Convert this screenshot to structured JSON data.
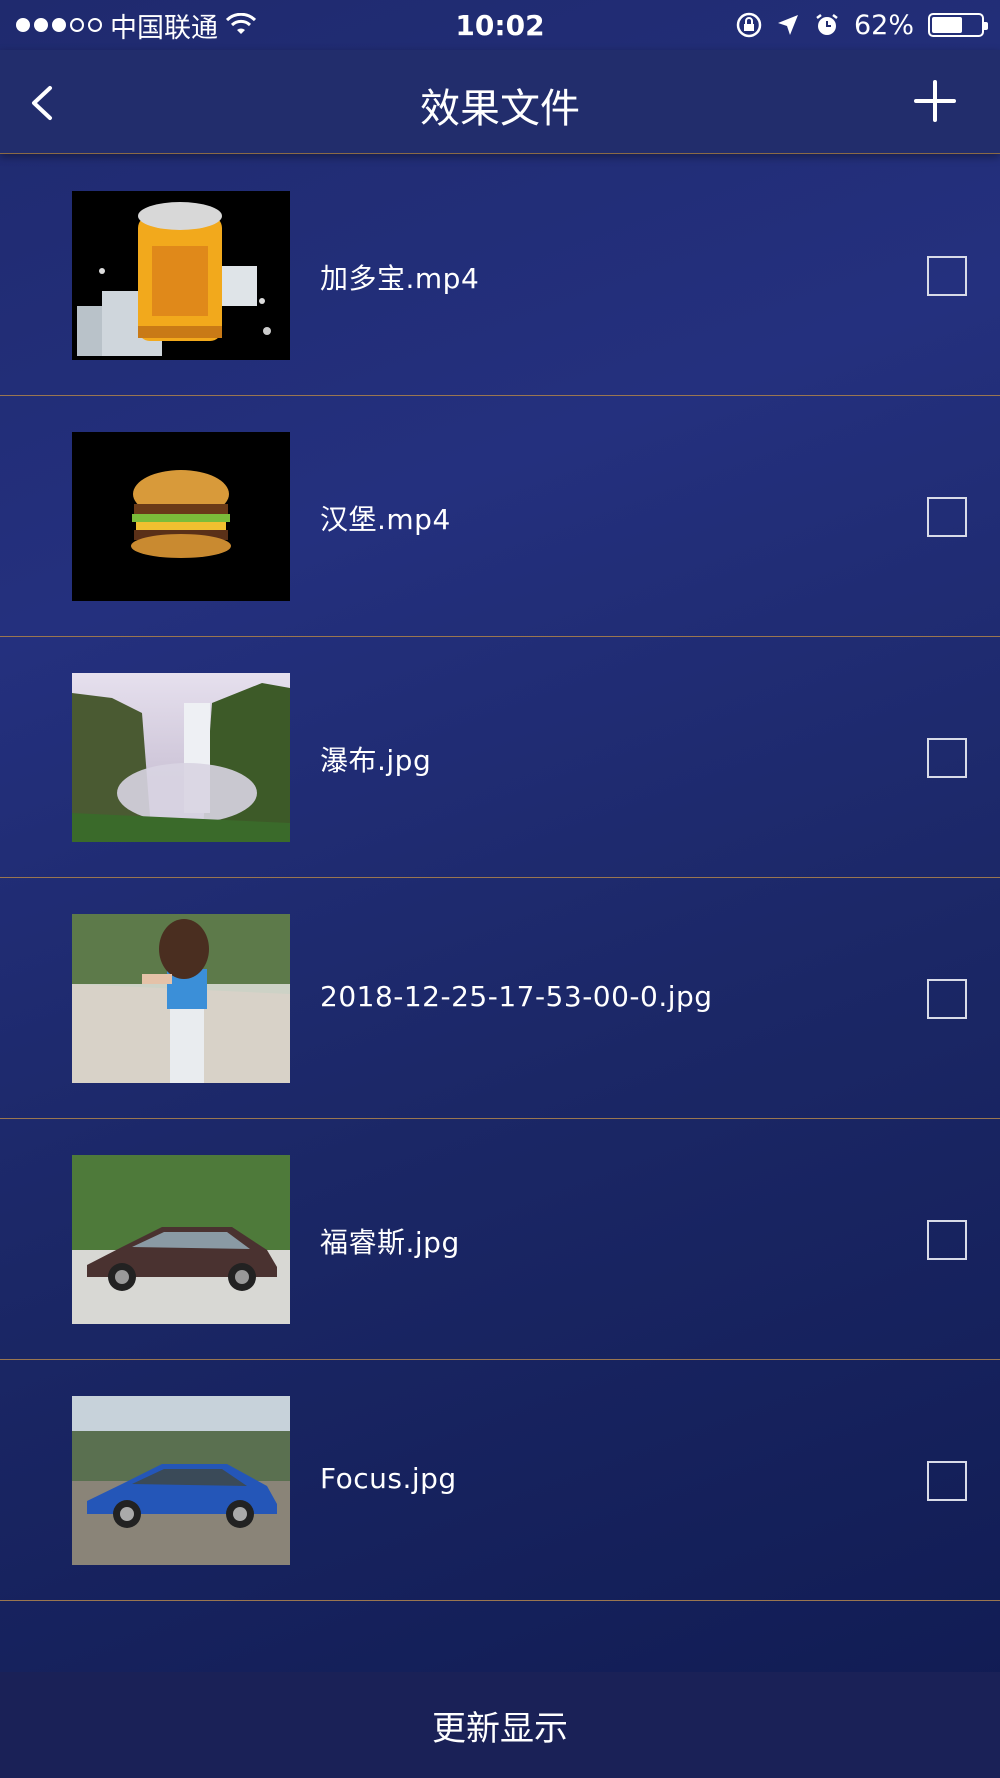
{
  "status_bar": {
    "carrier": "中国联通",
    "time": "10:02",
    "battery_percent": "62%",
    "battery_level": 0.62,
    "signal_dots_filled": 3,
    "signal_dots_total": 5
  },
  "nav": {
    "title": "效果文件",
    "back_icon": "chevron-left-icon",
    "add_icon": "plus-icon"
  },
  "files": [
    {
      "name": "加多宝.mp4",
      "thumb": "drink-can-on-ice",
      "checked": false
    },
    {
      "name": "汉堡.mp4",
      "thumb": "hamburger",
      "checked": false
    },
    {
      "name": "瀑布.jpg",
      "thumb": "waterfall",
      "checked": false
    },
    {
      "name": "2018-12-25-17-53-00-0.jpg",
      "thumb": "woman-on-beach",
      "checked": false
    },
    {
      "name": "福睿斯.jpg",
      "thumb": "brown-sedan",
      "checked": false
    },
    {
      "name": "Focus.jpg",
      "thumb": "blue-sedan",
      "checked": false
    }
  ],
  "bottom_button": "更新显示",
  "colors": {
    "background": "#1f2a6e",
    "separator": "#9a7650",
    "bottom_bar": "#1a2157"
  }
}
